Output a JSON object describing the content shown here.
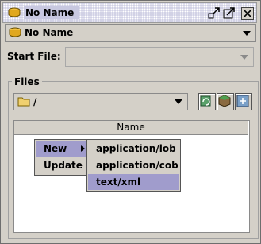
{
  "window": {
    "title": "No Name",
    "selector_value": "No Name"
  },
  "start_file": {
    "label": "Start File:",
    "value": ""
  },
  "files": {
    "group_label": "Files",
    "path": "/",
    "column_header": "Name"
  },
  "context_menu": {
    "items": [
      {
        "label": "New",
        "has_submenu": true
      },
      {
        "label": "Update",
        "has_submenu": false
      }
    ]
  },
  "submenu": {
    "items": [
      {
        "label": "application/lob"
      },
      {
        "label": "application/cob"
      },
      {
        "label": "text/xml",
        "selected": true
      }
    ]
  },
  "icons": [
    "database-icon",
    "float-icon",
    "maximize-icon",
    "close-icon",
    "folder-icon",
    "refresh-icon",
    "cube-icon",
    "add-file-icon"
  ],
  "colors": {
    "selection": "#a09ccc",
    "title_bg": "#c8c8e0"
  }
}
